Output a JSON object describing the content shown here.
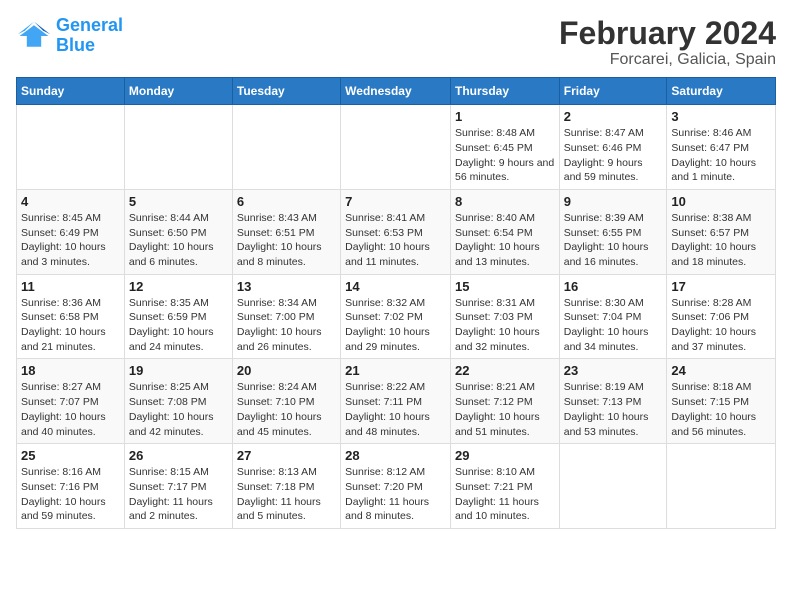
{
  "logo": {
    "line1": "General",
    "line2": "Blue"
  },
  "title": "February 2024",
  "subtitle": "Forcarei, Galicia, Spain",
  "days_of_week": [
    "Sunday",
    "Monday",
    "Tuesday",
    "Wednesday",
    "Thursday",
    "Friday",
    "Saturday"
  ],
  "weeks": [
    [
      {
        "num": "",
        "info": ""
      },
      {
        "num": "",
        "info": ""
      },
      {
        "num": "",
        "info": ""
      },
      {
        "num": "",
        "info": ""
      },
      {
        "num": "1",
        "info": "Sunrise: 8:48 AM\nSunset: 6:45 PM\nDaylight: 9 hours and 56 minutes."
      },
      {
        "num": "2",
        "info": "Sunrise: 8:47 AM\nSunset: 6:46 PM\nDaylight: 9 hours and 59 minutes."
      },
      {
        "num": "3",
        "info": "Sunrise: 8:46 AM\nSunset: 6:47 PM\nDaylight: 10 hours and 1 minute."
      }
    ],
    [
      {
        "num": "4",
        "info": "Sunrise: 8:45 AM\nSunset: 6:49 PM\nDaylight: 10 hours and 3 minutes."
      },
      {
        "num": "5",
        "info": "Sunrise: 8:44 AM\nSunset: 6:50 PM\nDaylight: 10 hours and 6 minutes."
      },
      {
        "num": "6",
        "info": "Sunrise: 8:43 AM\nSunset: 6:51 PM\nDaylight: 10 hours and 8 minutes."
      },
      {
        "num": "7",
        "info": "Sunrise: 8:41 AM\nSunset: 6:53 PM\nDaylight: 10 hours and 11 minutes."
      },
      {
        "num": "8",
        "info": "Sunrise: 8:40 AM\nSunset: 6:54 PM\nDaylight: 10 hours and 13 minutes."
      },
      {
        "num": "9",
        "info": "Sunrise: 8:39 AM\nSunset: 6:55 PM\nDaylight: 10 hours and 16 minutes."
      },
      {
        "num": "10",
        "info": "Sunrise: 8:38 AM\nSunset: 6:57 PM\nDaylight: 10 hours and 18 minutes."
      }
    ],
    [
      {
        "num": "11",
        "info": "Sunrise: 8:36 AM\nSunset: 6:58 PM\nDaylight: 10 hours and 21 minutes."
      },
      {
        "num": "12",
        "info": "Sunrise: 8:35 AM\nSunset: 6:59 PM\nDaylight: 10 hours and 24 minutes."
      },
      {
        "num": "13",
        "info": "Sunrise: 8:34 AM\nSunset: 7:00 PM\nDaylight: 10 hours and 26 minutes."
      },
      {
        "num": "14",
        "info": "Sunrise: 8:32 AM\nSunset: 7:02 PM\nDaylight: 10 hours and 29 minutes."
      },
      {
        "num": "15",
        "info": "Sunrise: 8:31 AM\nSunset: 7:03 PM\nDaylight: 10 hours and 32 minutes."
      },
      {
        "num": "16",
        "info": "Sunrise: 8:30 AM\nSunset: 7:04 PM\nDaylight: 10 hours and 34 minutes."
      },
      {
        "num": "17",
        "info": "Sunrise: 8:28 AM\nSunset: 7:06 PM\nDaylight: 10 hours and 37 minutes."
      }
    ],
    [
      {
        "num": "18",
        "info": "Sunrise: 8:27 AM\nSunset: 7:07 PM\nDaylight: 10 hours and 40 minutes."
      },
      {
        "num": "19",
        "info": "Sunrise: 8:25 AM\nSunset: 7:08 PM\nDaylight: 10 hours and 42 minutes."
      },
      {
        "num": "20",
        "info": "Sunrise: 8:24 AM\nSunset: 7:10 PM\nDaylight: 10 hours and 45 minutes."
      },
      {
        "num": "21",
        "info": "Sunrise: 8:22 AM\nSunset: 7:11 PM\nDaylight: 10 hours and 48 minutes."
      },
      {
        "num": "22",
        "info": "Sunrise: 8:21 AM\nSunset: 7:12 PM\nDaylight: 10 hours and 51 minutes."
      },
      {
        "num": "23",
        "info": "Sunrise: 8:19 AM\nSunset: 7:13 PM\nDaylight: 10 hours and 53 minutes."
      },
      {
        "num": "24",
        "info": "Sunrise: 8:18 AM\nSunset: 7:15 PM\nDaylight: 10 hours and 56 minutes."
      }
    ],
    [
      {
        "num": "25",
        "info": "Sunrise: 8:16 AM\nSunset: 7:16 PM\nDaylight: 10 hours and 59 minutes."
      },
      {
        "num": "26",
        "info": "Sunrise: 8:15 AM\nSunset: 7:17 PM\nDaylight: 11 hours and 2 minutes."
      },
      {
        "num": "27",
        "info": "Sunrise: 8:13 AM\nSunset: 7:18 PM\nDaylight: 11 hours and 5 minutes."
      },
      {
        "num": "28",
        "info": "Sunrise: 8:12 AM\nSunset: 7:20 PM\nDaylight: 11 hours and 8 minutes."
      },
      {
        "num": "29",
        "info": "Sunrise: 8:10 AM\nSunset: 7:21 PM\nDaylight: 11 hours and 10 minutes."
      },
      {
        "num": "",
        "info": ""
      },
      {
        "num": "",
        "info": ""
      }
    ]
  ]
}
